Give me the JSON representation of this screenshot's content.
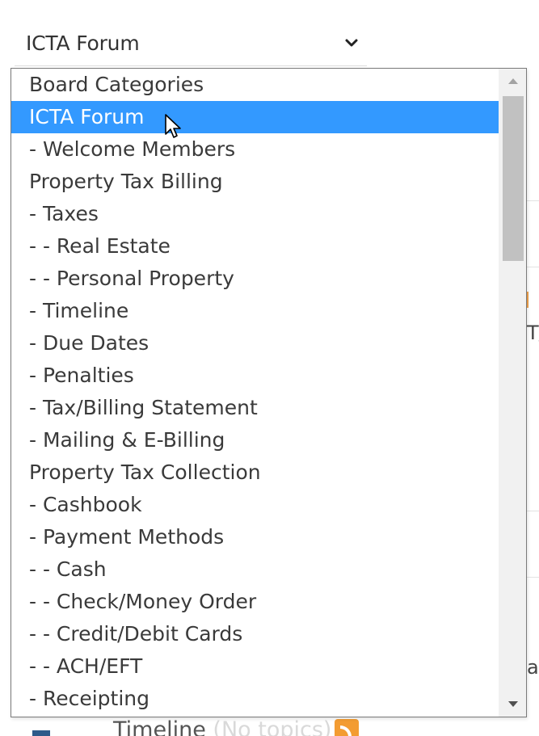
{
  "select": {
    "value": "ICTA Forum"
  },
  "dropdown": {
    "options": [
      {
        "label": "Board Categories",
        "selected": false
      },
      {
        "label": "ICTA Forum",
        "selected": true
      },
      {
        "label": "- Welcome Members",
        "selected": false
      },
      {
        "label": "Property Tax Billing",
        "selected": false
      },
      {
        "label": "- Taxes",
        "selected": false
      },
      {
        "label": "- - Real Estate",
        "selected": false
      },
      {
        "label": "- - Personal Property",
        "selected": false
      },
      {
        "label": "- Timeline",
        "selected": false
      },
      {
        "label": "- Due Dates",
        "selected": false
      },
      {
        "label": "- Penalties",
        "selected": false
      },
      {
        "label": "- Tax/Billing Statement",
        "selected": false
      },
      {
        "label": "- Mailing & E-Billing",
        "selected": false
      },
      {
        "label": "Property Tax Collection",
        "selected": false
      },
      {
        "label": "- Cashbook",
        "selected": false
      },
      {
        "label": "- Payment Methods",
        "selected": false
      },
      {
        "label": "- - Cash",
        "selected": false
      },
      {
        "label": "- - Check/Money Order",
        "selected": false
      },
      {
        "label": "- - Credit/Debit Cards",
        "selected": false
      },
      {
        "label": "- - ACH/EFT",
        "selected": false
      },
      {
        "label": "- Receipting",
        "selected": false
      }
    ]
  },
  "background": {
    "fragment_1": "T/",
    "fragment_2": "al",
    "bottom_title": "Timeline",
    "bottom_note": "(No topics)"
  },
  "colors": {
    "selected_bg": "#3399ff",
    "selected_text": "#ffffff",
    "rss": "#f39c32"
  },
  "icons": {
    "select_toggle": "chevron-down-icon",
    "scroll_up": "scroll-up-arrow-icon",
    "scroll_down": "scroll-down-arrow-icon",
    "pointer": "mouse-pointer-icon",
    "feed": "rss-icon"
  }
}
